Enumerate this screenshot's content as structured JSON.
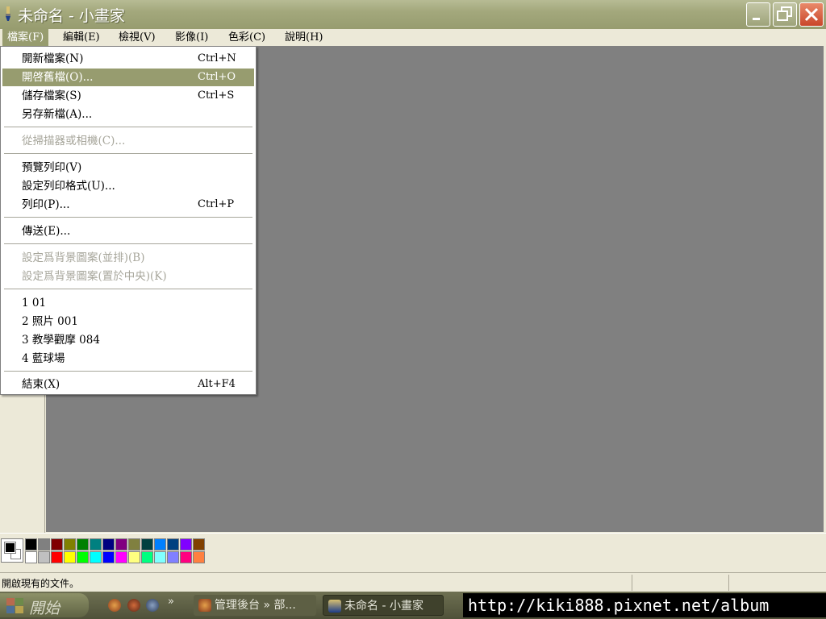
{
  "window": {
    "title": "未命名 - 小畫家",
    "app_icon": "paint-brush-icon",
    "controls": [
      "minimize-icon",
      "restore-icon",
      "close-icon"
    ]
  },
  "menubar": {
    "items": [
      {
        "label": "檔案(F)",
        "active": true
      },
      {
        "label": "編輯(E)"
      },
      {
        "label": "檢視(V)"
      },
      {
        "label": "影像(I)"
      },
      {
        "label": "色彩(C)"
      },
      {
        "label": "說明(H)"
      }
    ]
  },
  "file_menu": {
    "items": [
      {
        "label": "開新檔案(N)",
        "shortcut": "Ctrl+N"
      },
      {
        "label": "開啓舊檔(O)...",
        "shortcut": "Ctrl+O",
        "highlighted": true
      },
      {
        "label": "儲存檔案(S)",
        "shortcut": "Ctrl+S"
      },
      {
        "label": "另存新檔(A)...",
        "shortcut": ""
      },
      {
        "label": "從掃描器或相機(C)...",
        "shortcut": "",
        "disabled": true
      },
      {
        "label": "預覽列印(V)",
        "shortcut": ""
      },
      {
        "label": "設定列印格式(U)...",
        "shortcut": ""
      },
      {
        "label": "列印(P)...",
        "shortcut": "Ctrl+P"
      },
      {
        "label": "傳送(E)...",
        "shortcut": ""
      },
      {
        "label": "設定爲背景圖案(並排)(B)",
        "shortcut": "",
        "disabled": true
      },
      {
        "label": "設定爲背景圖案(置於中央)(K)",
        "shortcut": "",
        "disabled": true
      },
      {
        "label": "1 01",
        "shortcut": ""
      },
      {
        "label": "2 照片 001",
        "shortcut": ""
      },
      {
        "label": "3 教學觀摩 084",
        "shortcut": ""
      },
      {
        "label": "4 藍球場",
        "shortcut": ""
      },
      {
        "label": "結束(X)",
        "shortcut": "Alt+F4"
      }
    ]
  },
  "palette": {
    "foreground": "#000000",
    "background": "#ffffff",
    "top_row": [
      "#000000",
      "#808080",
      "#800000",
      "#808000",
      "#008000",
      "#008080",
      "#000080",
      "#800080",
      "#808040",
      "#004040",
      "#0080ff",
      "#004080",
      "#8000ff",
      "#804000"
    ],
    "bottom_row": [
      "#ffffff",
      "#c0c0c0",
      "#ff0000",
      "#ffff00",
      "#00ff00",
      "#00ffff",
      "#0000ff",
      "#ff00ff",
      "#ffff80",
      "#00ff80",
      "#80ffff",
      "#8080ff",
      "#ff0080",
      "#ff8040"
    ]
  },
  "status": {
    "text": "開啟現有的文件。"
  },
  "taskbar": {
    "start_label": "開始",
    "quick_launch": [
      "firefox-icon",
      "media-icon",
      "player-icon"
    ],
    "overflow": "»",
    "tasks": [
      {
        "label": "管理後台 » 部...",
        "icon": "browser-icon"
      },
      {
        "label": "未命名 - 小畫家",
        "icon": "paint-icon"
      }
    ]
  },
  "watermark": "http://kiki888.pixnet.net/album",
  "colors": {
    "titlebar": "#a3a87c",
    "menu_highlight": "#979c6f",
    "canvas_bg": "#808080"
  }
}
